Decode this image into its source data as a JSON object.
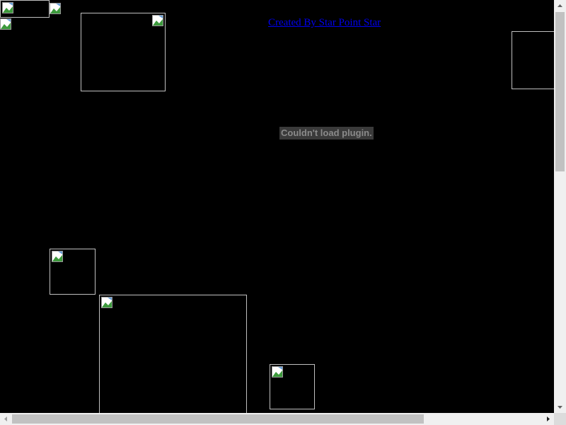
{
  "page": {
    "background": "#000000"
  },
  "link": {
    "text": "Created By Star Point Star",
    "color": "#0000ee"
  },
  "plugin": {
    "error_text": "Couldn't load plugin."
  },
  "images": [
    {
      "name": "broken-image-1"
    },
    {
      "name": "broken-image-2"
    },
    {
      "name": "broken-image-3"
    },
    {
      "name": "broken-image-4"
    },
    {
      "name": "broken-image-5"
    },
    {
      "name": "broken-image-6"
    },
    {
      "name": "broken-image-7"
    },
    {
      "name": "broken-image-8"
    },
    {
      "name": "broken-image-9"
    }
  ],
  "icons": {
    "broken_image": "broken-image-icon",
    "scroll_up": "chevron-up-icon",
    "scroll_down": "chevron-down-icon",
    "scroll_left": "chevron-left-icon",
    "scroll_right": "chevron-right-icon"
  }
}
